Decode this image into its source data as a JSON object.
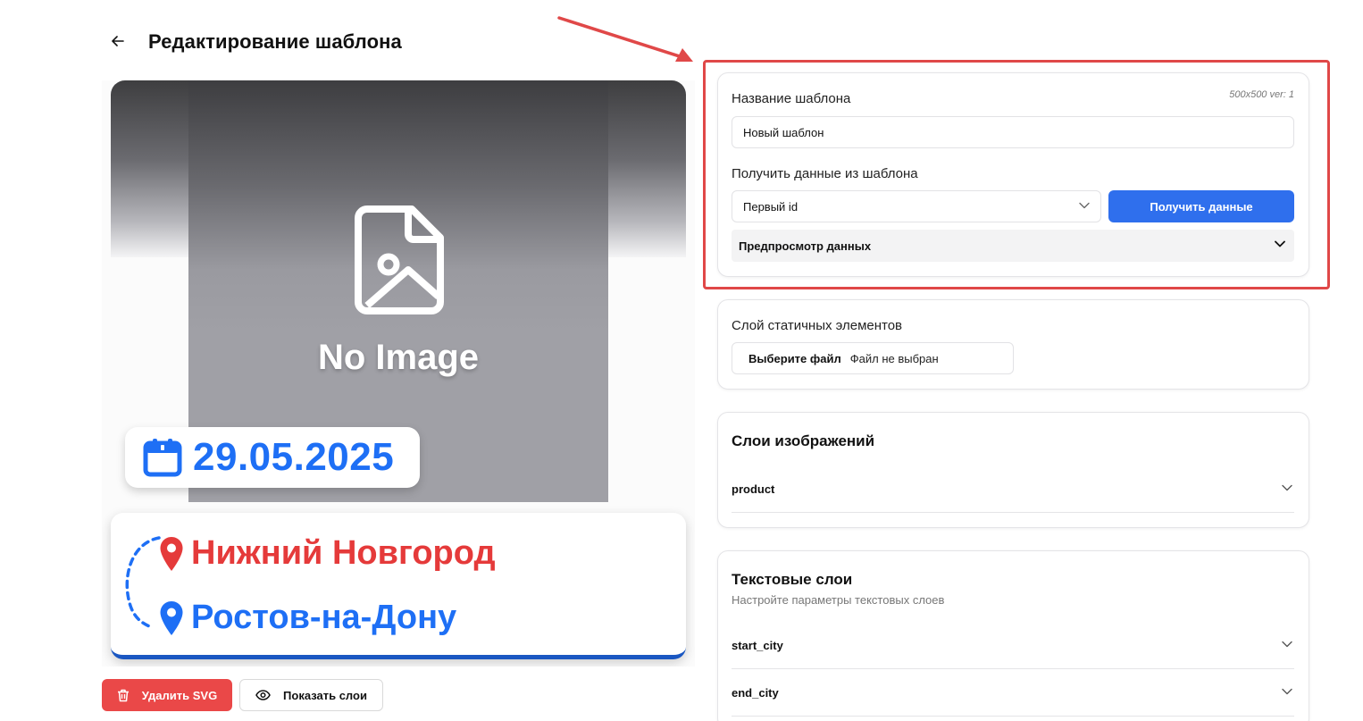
{
  "header": {
    "title": "Редактирование шаблона"
  },
  "preview": {
    "placeholder_text": "No Image",
    "date": "29.05.2025",
    "start_city": "Нижний Новгород",
    "end_city": "Ростов-на-Дону"
  },
  "actions": {
    "delete_label": "Удалить SVG",
    "show_layers_label": "Показать слои"
  },
  "template_card": {
    "name_label": "Название шаблона",
    "meta": "500x500  ver: 1",
    "name_value": "Новый шаблон",
    "source_label": "Получить данные из шаблона",
    "source_selected": "Первый id",
    "fetch_button": "Получить данные",
    "preview_accordion": "Предпросмотр данных"
  },
  "static_layer_card": {
    "label": "Слой статичных элементов",
    "file_button": "Выберите файл",
    "file_status": "Файл не выбран"
  },
  "image_layers_card": {
    "title": "Слои изображений",
    "items": [
      "product"
    ]
  },
  "text_layers_card": {
    "title": "Текстовые слои",
    "subtitle": "Настройте параметры текстовых слоев",
    "items": [
      "start_city",
      "end_city"
    ]
  },
  "colors": {
    "accent_blue": "#2f6fed",
    "danger_red": "#ea4848",
    "highlight_red": "#e04848",
    "city_red": "#e53a3a",
    "city_blue": "#1e6ff5"
  }
}
